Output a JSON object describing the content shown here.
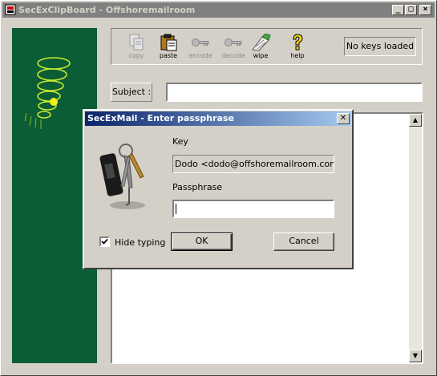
{
  "window": {
    "title": "SecExClipBoard - Offshoremailroom"
  },
  "titlebar_buttons": {
    "minimize": "_",
    "maximize": "□",
    "close": "×"
  },
  "toolbar": {
    "items": [
      {
        "label": "copy",
        "icon": "copy-icon",
        "enabled": false
      },
      {
        "label": "paste",
        "icon": "paste-icon",
        "enabled": true
      },
      {
        "label": "encode",
        "icon": "key-icon",
        "enabled": false
      },
      {
        "label": "decode",
        "icon": "key-icon",
        "enabled": false
      },
      {
        "label": "wipe",
        "icon": "wipe-icon",
        "enabled": true
      },
      {
        "label": "help",
        "icon": "help-icon",
        "enabled": true
      }
    ],
    "status": "No keys loaded"
  },
  "subject": {
    "label": "Subject :",
    "value": ""
  },
  "dialog": {
    "title": "SecExMail - Enter passphrase",
    "key_label": "Key",
    "key_value": "Dodo <dodo@offshoremailroom.com>",
    "passphrase_label": "Passphrase",
    "passphrase_value": "",
    "hide_typing_label": "Hide typing",
    "hide_typing_checked": true,
    "ok_label": "OK",
    "cancel_label": "Cancel"
  },
  "colors": {
    "sidebar": "#0a5d34",
    "title_active": "#0a246a",
    "title_inactive": "#808080"
  }
}
